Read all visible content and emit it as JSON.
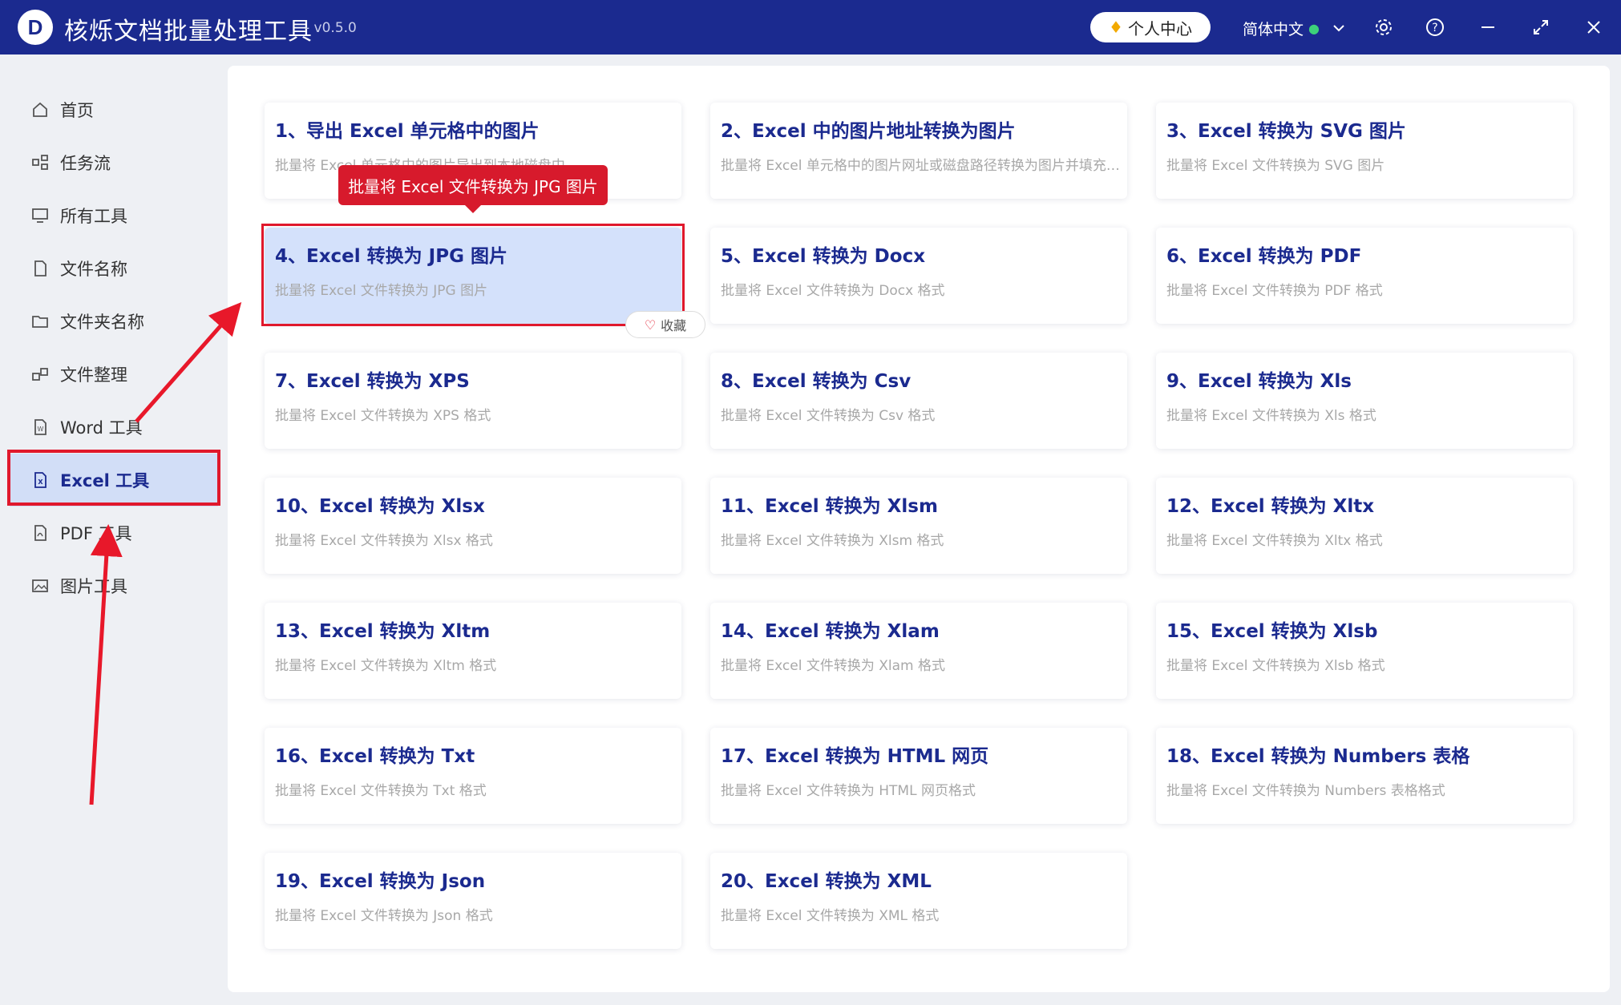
{
  "titlebar": {
    "logo_letter": "D",
    "title": "核烁文档批量处理工具",
    "version": "- v0.5.0",
    "user_center": "个人中心",
    "language": "简体中文"
  },
  "sidebar": {
    "items": [
      {
        "label": "首页",
        "icon": "home-icon"
      },
      {
        "label": "任务流",
        "icon": "workflow-icon"
      },
      {
        "label": "所有工具",
        "icon": "monitor-icon"
      },
      {
        "label": "文件名称",
        "icon": "file-icon"
      },
      {
        "label": "文件夹名称",
        "icon": "folder-icon"
      },
      {
        "label": "文件整理",
        "icon": "organize-icon"
      },
      {
        "label": "Word 工具",
        "icon": "word-icon"
      },
      {
        "label": "Excel 工具",
        "icon": "excel-icon",
        "active": true
      },
      {
        "label": "PDF 工具",
        "icon": "pdf-icon"
      },
      {
        "label": "图片工具",
        "icon": "image-icon"
      }
    ]
  },
  "tooltip": "批量将 Excel 文件转换为 JPG 图片",
  "favorite_label": "收藏",
  "cards": [
    {
      "title": "1、导出 Excel 单元格中的图片",
      "desc": "批量将 Excel 单元格中的图片导出到本地磁盘中"
    },
    {
      "title": "2、Excel 中的图片地址转换为图片",
      "desc": "批量将 Excel 单元格中的图片网址或磁盘路径转换为图片并填充到单元格中"
    },
    {
      "title": "3、Excel 转换为 SVG 图片",
      "desc": "批量将 Excel 文件转换为 SVG 图片"
    },
    {
      "title": "4、Excel 转换为 JPG 图片",
      "desc": "批量将 Excel 文件转换为 JPG 图片"
    },
    {
      "title": "5、Excel 转换为 Docx",
      "desc": "批量将 Excel 文件转换为 Docx 格式"
    },
    {
      "title": "6、Excel 转换为 PDF",
      "desc": "批量将 Excel 文件转换为 PDF 格式"
    },
    {
      "title": "7、Excel 转换为 XPS",
      "desc": "批量将 Excel 文件转换为 XPS 格式"
    },
    {
      "title": "8、Excel 转换为 Csv",
      "desc": "批量将 Excel 文件转换为 Csv 格式"
    },
    {
      "title": "9、Excel 转换为 Xls",
      "desc": "批量将 Excel 文件转换为 Xls 格式"
    },
    {
      "title": "10、Excel 转换为 Xlsx",
      "desc": "批量将 Excel 文件转换为 Xlsx 格式"
    },
    {
      "title": "11、Excel 转换为 Xlsm",
      "desc": "批量将 Excel 文件转换为 Xlsm 格式"
    },
    {
      "title": "12、Excel 转换为 Xltx",
      "desc": "批量将 Excel 文件转换为 Xltx 格式"
    },
    {
      "title": "13、Excel 转换为 Xltm",
      "desc": "批量将 Excel 文件转换为 Xltm 格式"
    },
    {
      "title": "14、Excel 转换为 Xlam",
      "desc": "批量将 Excel 文件转换为 Xlam 格式"
    },
    {
      "title": "15、Excel 转换为 Xlsb",
      "desc": "批量将 Excel 文件转换为 Xlsb 格式"
    },
    {
      "title": "16、Excel 转换为 Txt",
      "desc": "批量将 Excel 文件转换为 Txt 格式"
    },
    {
      "title": "17、Excel 转换为 HTML 网页",
      "desc": "批量将 Excel 文件转换为 HTML 网页格式"
    },
    {
      "title": "18、Excel 转换为 Numbers 表格",
      "desc": "批量将 Excel 文件转换为 Numbers 表格格式"
    },
    {
      "title": "19、Excel 转换为 Json",
      "desc": "批量将 Excel 文件转换为 Json 格式"
    },
    {
      "title": "20、Excel 转换为 XML",
      "desc": "批量将 Excel 文件转换为 XML 格式"
    }
  ],
  "colors": {
    "titlebar": "#1b2a8f",
    "accent_red": "#e0182c",
    "active_bg": "#d2def7",
    "card_title": "#1b2a8f"
  }
}
